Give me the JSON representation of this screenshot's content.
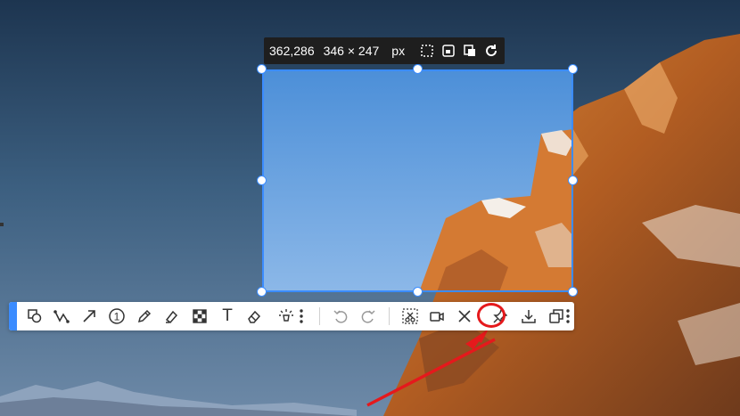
{
  "info_bar": {
    "coords": "362,286",
    "size": "346 × 247",
    "unit": "px",
    "icons": [
      "selection-rect-icon",
      "window-icon",
      "screenshot-icon",
      "refresh-icon"
    ]
  },
  "toolbar": {
    "tools": [
      {
        "name": "shape-tool",
        "icon": "shape-icon"
      },
      {
        "name": "polyline-tool",
        "icon": "polyline-icon"
      },
      {
        "name": "arrow-tool",
        "icon": "arrow-icon"
      },
      {
        "name": "number-tool",
        "icon": "number-circle-icon",
        "label": "1"
      },
      {
        "name": "pencil-tool",
        "icon": "pencil-icon"
      },
      {
        "name": "marker-tool",
        "icon": "marker-icon"
      },
      {
        "name": "mosaic-tool",
        "icon": "mosaic-icon"
      },
      {
        "name": "text-tool",
        "icon": "text-icon",
        "label": "T"
      },
      {
        "name": "eraser-tool",
        "icon": "eraser-icon"
      },
      {
        "name": "magic-tool",
        "icon": "magic-light-icon"
      },
      {
        "name": "more-tools",
        "icon": "more-vertical-icon"
      },
      {
        "name": "undo",
        "icon": "undo-icon"
      },
      {
        "name": "redo",
        "icon": "redo-icon"
      },
      {
        "name": "crop-cut",
        "icon": "scissors-icon"
      },
      {
        "name": "record",
        "icon": "video-icon"
      },
      {
        "name": "close",
        "icon": "close-icon"
      },
      {
        "name": "pin",
        "icon": "pin-icon"
      },
      {
        "name": "download",
        "icon": "download-icon"
      },
      {
        "name": "copy",
        "icon": "copy-icon"
      },
      {
        "name": "more-actions",
        "icon": "more-vertical-icon"
      }
    ]
  },
  "colors": {
    "selection": "#3b8cff",
    "annotation": "#e5191c",
    "toolbar_bg": "#ffffff"
  }
}
